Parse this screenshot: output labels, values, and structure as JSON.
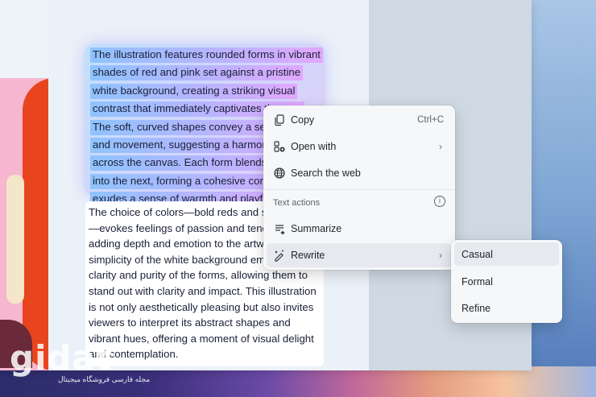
{
  "document": {
    "selected_lines": [
      "The illustration features rounded forms in vibrant",
      "shades of red and pink set against a pristine",
      "white background, creating a striking visual",
      "contrast that immediately captivates the eye.",
      "The soft, curved shapes convey a sense of flow",
      "and movement, suggesting a harmonious dance",
      "across the canvas. Each form blends seamlessly",
      "into the next, forming a cohesive composition that",
      "exudes a sense of warmth and playfulness."
    ],
    "paragraph_lines": [
      "The choice of colors—bold reds and soft pinks",
      "—evokes feelings of passion and tenderness,",
      "adding depth and emotion to the artwork. The",
      "simplicity of the white background emphasizes the",
      "clarity and purity of the forms, allowing them to",
      "stand out with clarity and impact. This illustration",
      "is not only aesthetically pleasing but also invites",
      "viewers to interpret its abstract shapes and",
      "vibrant hues, offering a moment of visual delight",
      "and contemplation."
    ]
  },
  "context_menu": {
    "copy": {
      "label": "Copy",
      "shortcut": "Ctrl+C",
      "icon": "copy-icon"
    },
    "open_with": {
      "label": "Open with",
      "icon": "open-with-icon"
    },
    "search_web": {
      "label": "Search the web",
      "icon": "globe-icon"
    },
    "section_label": "Text actions",
    "summarize": {
      "label": "Summarize",
      "icon": "summarize-icon"
    },
    "rewrite": {
      "label": "Rewrite",
      "icon": "rewrite-icon"
    }
  },
  "rewrite_submenu": {
    "items": [
      "Casual",
      "Formal",
      "Refine"
    ]
  },
  "watermark": {
    "logo": "gidat",
    "domain": ".ir",
    "tagline": "مجله فارسی فروشگاه میجیتال"
  }
}
